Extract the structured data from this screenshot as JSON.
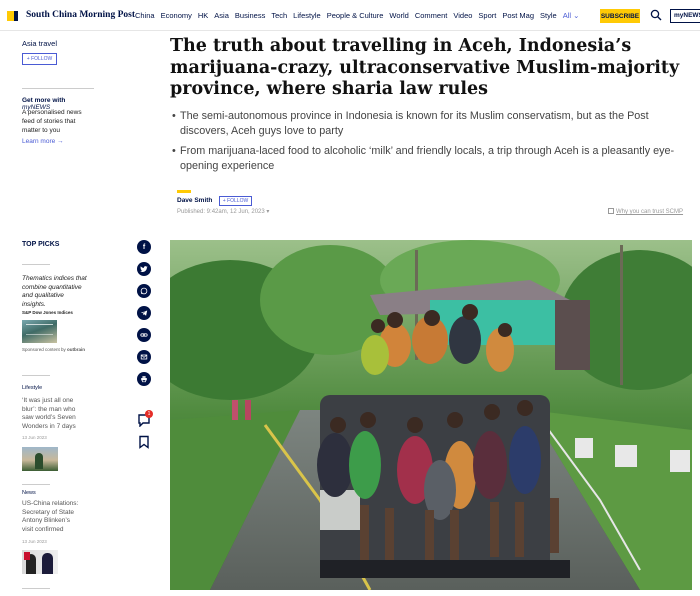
{
  "nav": {
    "logo": "South China Morning Post",
    "items": [
      "China",
      "Economy",
      "HK",
      "Asia",
      "Business",
      "Tech",
      "Lifestyle",
      "People & Culture",
      "World",
      "Comment",
      "Video",
      "Sport",
      "Post Mag",
      "Style"
    ],
    "all_label": "All",
    "subscribe_label": "SUBSCRIBE",
    "mynews_label": "myNEWS",
    "brand_yellow": "#ffca05",
    "brand_navy": "#001246"
  },
  "left": {
    "section": "Asia travel",
    "follow_label": "+ FOLLOW",
    "getmore_prefix": "Get more with ",
    "getmore_brand": "myNEWS",
    "getmore_desc": "A personalised news feed of stories that matter to you",
    "learn_more": "Learn more →",
    "top_picks": "TOP PICKS",
    "tp_quote": "Thematics indices that combine quantitative and qualitative insights.",
    "tp_sub": "S&P Dow Jones Indices",
    "tp_sponsored": "Sponsored content by",
    "tp_sponsor": "outbrain",
    "stories": [
      {
        "category": "Lifestyle",
        "title": "‘It was just all one blur’: the man who saw world’s Seven Wonders in 7 days",
        "date": "13 Jun 2023"
      },
      {
        "category": "News",
        "title": "US-China relations: Secretary of State Antony Blinken’s visit confirmed",
        "date": "13 Jun 2023"
      }
    ]
  },
  "share": {
    "icons": [
      "facebook-icon",
      "twitter-icon",
      "whatsapp-icon",
      "telegram-icon",
      "link-icon",
      "email-icon",
      "print-icon",
      "comment-icon",
      "bookmark-icon"
    ],
    "comment_count": "1"
  },
  "article": {
    "headline": "The truth about travelling in Aceh, Indonesia’s marijuana-crazy, ultraconservative Muslim-majority province, where sharia law rules",
    "bullets": [
      "The semi-autonomous province in Indonesia is known for its Muslim conservatism, but as the Post discovers, Aceh guys love to party",
      "From marijuana-laced food to alcoholic ‘milk’ and friendly locals, a trip through Aceh is a pleasantly eye-opening experience"
    ],
    "author": "Dave Smith",
    "author_follow": "+ FOLLOW",
    "published": "Published: 9:42am, 12 Jun, 2023",
    "trust": "Why you can trust SCMP"
  }
}
